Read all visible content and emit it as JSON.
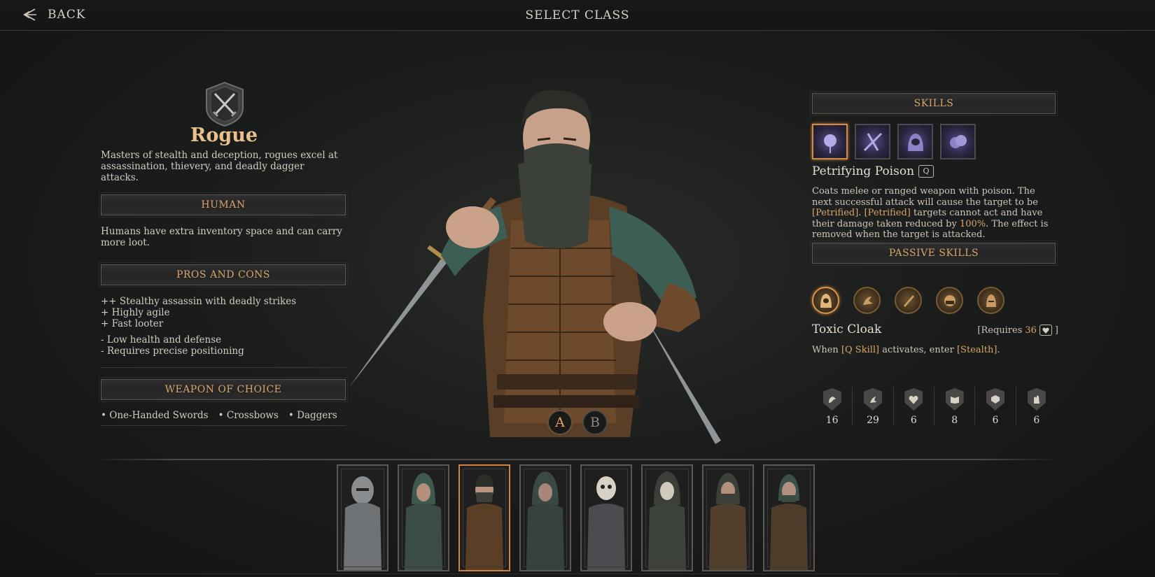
{
  "topbar": {
    "back_label": "BACK",
    "title": "SELECT CLASS"
  },
  "class": {
    "name": "Rogue",
    "description": "Masters of stealth and deception, rogues excel at assassination, thievery, and deadly dagger attacks."
  },
  "race": {
    "header": "HUMAN",
    "description": "Humans have extra inventory space and can carry more loot."
  },
  "pros_cons": {
    "header": "PROS AND CONS",
    "pros": [
      "++ Stealthy assassin with deadly strikes",
      "+ Highly agile",
      "+ Fast looter"
    ],
    "cons": [
      "- Low health and defense",
      "- Requires precise positioning"
    ]
  },
  "weapons": {
    "header": "WEAPON OF CHOICE",
    "items": [
      "• One-Handed Swords",
      "• Crossbows",
      "• Daggers"
    ]
  },
  "loadout_buttons": {
    "a": "A",
    "b": "B"
  },
  "skills": {
    "header": "SKILLS",
    "selected_name": "Petrifying Poison",
    "key": "Q",
    "desc_1": "Coats melee or ranged weapon with poison. The next successful attack will cause the target to be ",
    "desc_hl1": "[Petrified]",
    "desc_2": ".",
    "desc_hl2": "[Petrified]",
    "desc_3": " targets cannot act and have their damage taken reduced by ",
    "desc_hl3": "100%",
    "desc_4": ". The effect is removed when the target is attacked."
  },
  "passive": {
    "header": "PASSIVE SKILLS",
    "selected_name": "Toxic Cloak",
    "req_prefix": "[Requires",
    "req_value": "36",
    "req_suffix": "]",
    "desc_1": "When ",
    "desc_hl1": "[Q Skill]",
    "desc_2": " activates, enter ",
    "desc_hl2": "[Stealth]",
    "desc_3": "."
  },
  "stats": [
    {
      "icon": "strength-icon",
      "value": "16"
    },
    {
      "icon": "agility-icon",
      "value": "29"
    },
    {
      "icon": "vitality-icon",
      "value": "6"
    },
    {
      "icon": "knowledge-icon",
      "value": "8"
    },
    {
      "icon": "resourcefulness-icon",
      "value": "6"
    },
    {
      "icon": "will-icon",
      "value": "6"
    }
  ],
  "colors": {
    "accent": "#d9a56b",
    "selected_border": "#d0803f",
    "skill_purple": "#5a4d86"
  }
}
